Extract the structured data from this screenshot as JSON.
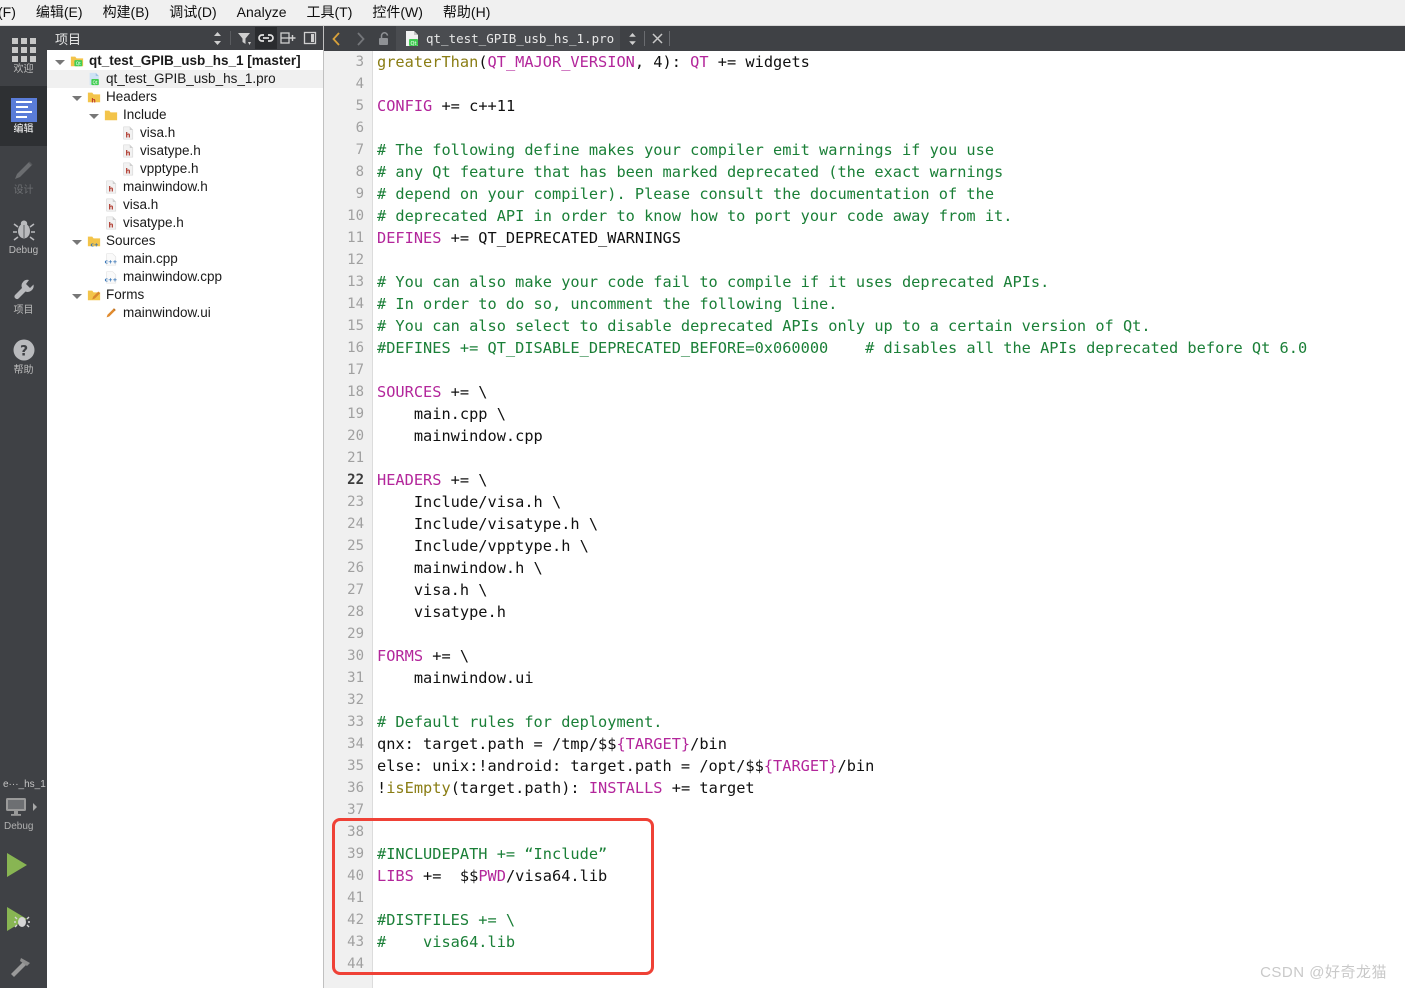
{
  "menubar": {
    "items": [
      {
        "label": "件(F)",
        "mnemonic": "F"
      },
      {
        "label": "编辑(E)",
        "mnemonic": "E"
      },
      {
        "label": "构建(B)",
        "mnemonic": "B"
      },
      {
        "label": "调试(D)",
        "mnemonic": "D"
      },
      {
        "label": "Analyze",
        "mnemonic": "A"
      },
      {
        "label": "工具(T)",
        "mnemonic": "T"
      },
      {
        "label": "控件(W)",
        "mnemonic": "W"
      },
      {
        "label": "帮助(H)",
        "mnemonic": "H"
      }
    ]
  },
  "modebar": {
    "modes": [
      {
        "label": "欢迎",
        "icon": "grid-icon",
        "active": false
      },
      {
        "label": "编辑",
        "icon": "editor-icon",
        "active": true
      },
      {
        "label": "设计",
        "icon": "pencil-icon",
        "active": false,
        "disabled": true
      },
      {
        "label": "Debug",
        "icon": "bug-icon",
        "active": false
      },
      {
        "label": "项目",
        "icon": "wrench-icon",
        "active": false
      },
      {
        "label": "帮助",
        "icon": "question-icon",
        "active": false
      }
    ],
    "kit": {
      "project": "e···_hs_1",
      "build_config": "Debug",
      "selector_icon": "desktop-kit-icon",
      "run_label": "run-button",
      "debug_label": "debug-button",
      "build_label": "build-button"
    }
  },
  "project_panel": {
    "title": "项目",
    "header_buttons": [
      {
        "name": "sync-selection-button",
        "icon": "up-down-arrows-icon"
      },
      {
        "name": "filter-button",
        "icon": "filter-icon"
      },
      {
        "name": "link-with-editor-button",
        "icon": "link-icon",
        "active": true
      },
      {
        "name": "split-add-button",
        "icon": "split-add-icon"
      },
      {
        "name": "close-sidebar-button",
        "icon": "sidebar-toggle-icon"
      }
    ],
    "tree": [
      {
        "label": "qt_test_GPIB_usb_hs_1 [master]",
        "depth": 0,
        "icon": "qt-project-icon",
        "twisty": "open",
        "bold": true,
        "selected": false
      },
      {
        "label": "qt_test_GPIB_usb_hs_1.pro",
        "depth": 1,
        "icon": "pro-file-icon",
        "twisty": "none",
        "bold": false,
        "selected": true
      },
      {
        "label": "Headers",
        "depth": 1,
        "icon": "headers-folder-icon",
        "twisty": "open",
        "bold": false,
        "selected": false
      },
      {
        "label": "Include",
        "depth": 2,
        "icon": "folder-icon",
        "twisty": "open",
        "bold": false,
        "selected": false
      },
      {
        "label": "visa.h",
        "depth": 3,
        "icon": "h-file-icon",
        "twisty": "none",
        "bold": false,
        "selected": false
      },
      {
        "label": "visatype.h",
        "depth": 3,
        "icon": "h-file-icon",
        "twisty": "none",
        "bold": false,
        "selected": false
      },
      {
        "label": "vpptype.h",
        "depth": 3,
        "icon": "h-file-icon",
        "twisty": "none",
        "bold": false,
        "selected": false
      },
      {
        "label": "mainwindow.h",
        "depth": 2,
        "icon": "h-file-icon",
        "twisty": "none",
        "bold": false,
        "selected": false
      },
      {
        "label": "visa.h",
        "depth": 2,
        "icon": "h-file-icon",
        "twisty": "none",
        "bold": false,
        "selected": false
      },
      {
        "label": "visatype.h",
        "depth": 2,
        "icon": "h-file-icon",
        "twisty": "none",
        "bold": false,
        "selected": false
      },
      {
        "label": "Sources",
        "depth": 1,
        "icon": "sources-folder-icon",
        "twisty": "open",
        "bold": false,
        "selected": false
      },
      {
        "label": "main.cpp",
        "depth": 2,
        "icon": "cpp-file-icon",
        "twisty": "none",
        "bold": false,
        "selected": false
      },
      {
        "label": "mainwindow.cpp",
        "depth": 2,
        "icon": "cpp-file-icon",
        "twisty": "none",
        "bold": false,
        "selected": false
      },
      {
        "label": "Forms",
        "depth": 1,
        "icon": "forms-folder-icon",
        "twisty": "open",
        "bold": false,
        "selected": false
      },
      {
        "label": "mainwindow.ui",
        "depth": 2,
        "icon": "ui-file-icon",
        "twisty": "none",
        "bold": false,
        "selected": false
      }
    ]
  },
  "editor": {
    "tabbar": {
      "back_icon": "chevron-left-icon",
      "forward_icon": "chevron-right-icon",
      "lock_icon": "unlocked-icon",
      "file_icon": "qt-pro-file-icon",
      "filename": "qt_test_GPIB_usb_hs_1.pro",
      "split_icon": "up-down-arrows-icon",
      "close_icon": "close-icon"
    },
    "current_line": 22,
    "lines": [
      {
        "n": 3,
        "tokens": [
          {
            "t": "greaterThan",
            "c": "fn"
          },
          {
            "t": "(",
            "c": "pl"
          },
          {
            "t": "QT_MAJOR_VERSION",
            "c": "kw"
          },
          {
            "t": ", 4): ",
            "c": "pl"
          },
          {
            "t": "QT",
            "c": "kw"
          },
          {
            "t": " += widgets",
            "c": "pl"
          }
        ]
      },
      {
        "n": 4,
        "tokens": []
      },
      {
        "n": 5,
        "tokens": [
          {
            "t": "CONFIG",
            "c": "kw"
          },
          {
            "t": " += c++11",
            "c": "pl"
          }
        ]
      },
      {
        "n": 6,
        "tokens": []
      },
      {
        "n": 7,
        "tokens": [
          {
            "t": "# The following define makes your compiler emit warnings if you use",
            "c": "cm"
          }
        ]
      },
      {
        "n": 8,
        "tokens": [
          {
            "t": "# any Qt feature that has been marked deprecated (the exact warnings",
            "c": "cm"
          }
        ]
      },
      {
        "n": 9,
        "tokens": [
          {
            "t": "# depend on your compiler). Please consult the documentation of the",
            "c": "cm"
          }
        ]
      },
      {
        "n": 10,
        "tokens": [
          {
            "t": "# deprecated API in order to know how to port your code away from it.",
            "c": "cm"
          }
        ]
      },
      {
        "n": 11,
        "tokens": [
          {
            "t": "DEFINES",
            "c": "kw"
          },
          {
            "t": " += QT_DEPRECATED_WARNINGS",
            "c": "pl"
          }
        ]
      },
      {
        "n": 12,
        "tokens": []
      },
      {
        "n": 13,
        "tokens": [
          {
            "t": "# You can also make your code fail to compile if it uses deprecated APIs.",
            "c": "cm"
          }
        ]
      },
      {
        "n": 14,
        "tokens": [
          {
            "t": "# In order to do so, uncomment the following line.",
            "c": "cm"
          }
        ]
      },
      {
        "n": 15,
        "tokens": [
          {
            "t": "# You can also select to disable deprecated APIs only up to a certain version of Qt.",
            "c": "cm"
          }
        ]
      },
      {
        "n": 16,
        "tokens": [
          {
            "t": "#DEFINES += QT_DISABLE_DEPRECATED_BEFORE=0x060000    # disables all the APIs deprecated before Qt 6.0",
            "c": "cm"
          }
        ]
      },
      {
        "n": 17,
        "tokens": []
      },
      {
        "n": 18,
        "tokens": [
          {
            "t": "SOURCES",
            "c": "kw"
          },
          {
            "t": " += \\",
            "c": "pl"
          }
        ]
      },
      {
        "n": 19,
        "tokens": [
          {
            "t": "    main.cpp \\",
            "c": "pl"
          }
        ]
      },
      {
        "n": 20,
        "tokens": [
          {
            "t": "    mainwindow.cpp",
            "c": "pl"
          }
        ]
      },
      {
        "n": 21,
        "tokens": []
      },
      {
        "n": 22,
        "tokens": [
          {
            "t": "HEADERS",
            "c": "kw"
          },
          {
            "t": " += \\",
            "c": "pl"
          }
        ]
      },
      {
        "n": 23,
        "tokens": [
          {
            "t": "    Include/visa.h \\",
            "c": "pl"
          }
        ]
      },
      {
        "n": 24,
        "tokens": [
          {
            "t": "    Include/visatype.h \\",
            "c": "pl"
          }
        ]
      },
      {
        "n": 25,
        "tokens": [
          {
            "t": "    Include/vpptype.h \\",
            "c": "pl"
          }
        ]
      },
      {
        "n": 26,
        "tokens": [
          {
            "t": "    mainwindow.h \\",
            "c": "pl"
          }
        ]
      },
      {
        "n": 27,
        "tokens": [
          {
            "t": "    visa.h \\",
            "c": "pl"
          }
        ]
      },
      {
        "n": 28,
        "tokens": [
          {
            "t": "    visatype.h",
            "c": "pl"
          }
        ]
      },
      {
        "n": 29,
        "tokens": []
      },
      {
        "n": 30,
        "tokens": [
          {
            "t": "FORMS",
            "c": "kw"
          },
          {
            "t": " += \\",
            "c": "pl"
          }
        ]
      },
      {
        "n": 31,
        "tokens": [
          {
            "t": "    mainwindow.ui",
            "c": "pl"
          }
        ]
      },
      {
        "n": 32,
        "tokens": []
      },
      {
        "n": 33,
        "tokens": [
          {
            "t": "# Default rules for deployment.",
            "c": "cm"
          }
        ]
      },
      {
        "n": 34,
        "tokens": [
          {
            "t": "qnx: target.path = /tmp/$$",
            "c": "pl"
          },
          {
            "t": "{TARGET}",
            "c": "kw"
          },
          {
            "t": "/bin",
            "c": "pl"
          }
        ]
      },
      {
        "n": 35,
        "tokens": [
          {
            "t": "else: unix:!android: target.path = /opt/$$",
            "c": "pl"
          },
          {
            "t": "{TARGET}",
            "c": "kw"
          },
          {
            "t": "/bin",
            "c": "pl"
          }
        ]
      },
      {
        "n": 36,
        "tokens": [
          {
            "t": "!",
            "c": "pl"
          },
          {
            "t": "isEmpty",
            "c": "fn"
          },
          {
            "t": "(target.path): ",
            "c": "pl"
          },
          {
            "t": "INSTALLS",
            "c": "kw"
          },
          {
            "t": " += target",
            "c": "pl"
          }
        ]
      },
      {
        "n": 37,
        "tokens": []
      },
      {
        "n": 38,
        "tokens": []
      },
      {
        "n": 39,
        "tokens": [
          {
            "t": "#INCLUDEPATH += “Include”",
            "c": "cm"
          }
        ]
      },
      {
        "n": 40,
        "tokens": [
          {
            "t": "LIBS",
            "c": "kw"
          },
          {
            "t": " +=  $$",
            "c": "pl"
          },
          {
            "t": "PWD",
            "c": "kw"
          },
          {
            "t": "/visa64.lib",
            "c": "pl"
          }
        ]
      },
      {
        "n": 41,
        "tokens": []
      },
      {
        "n": 42,
        "tokens": [
          {
            "t": "#DISTFILES += \\",
            "c": "cm"
          }
        ]
      },
      {
        "n": 43,
        "tokens": [
          {
            "t": "#    visa64.lib",
            "c": "cm"
          }
        ]
      },
      {
        "n": 44,
        "tokens": []
      }
    ]
  },
  "annotation": {
    "highlight_box": {
      "name": "red-highlight-box",
      "color": "#ef4136",
      "covers_lines": "38-44"
    }
  },
  "watermark": {
    "text": "CSDN @好奇龙猫"
  },
  "colors": {
    "chrome_dark": "#3f4145",
    "editor_bg": "#ffffff",
    "gutter_bg": "#f0f0f0",
    "comment_green": "#1a7f37",
    "variable_magenta": "#b3269b",
    "function_olive": "#8a7d14",
    "highlight_red": "#ef4136",
    "mode_active_blue": "#5a7cd8",
    "run_green": "#88b553"
  }
}
